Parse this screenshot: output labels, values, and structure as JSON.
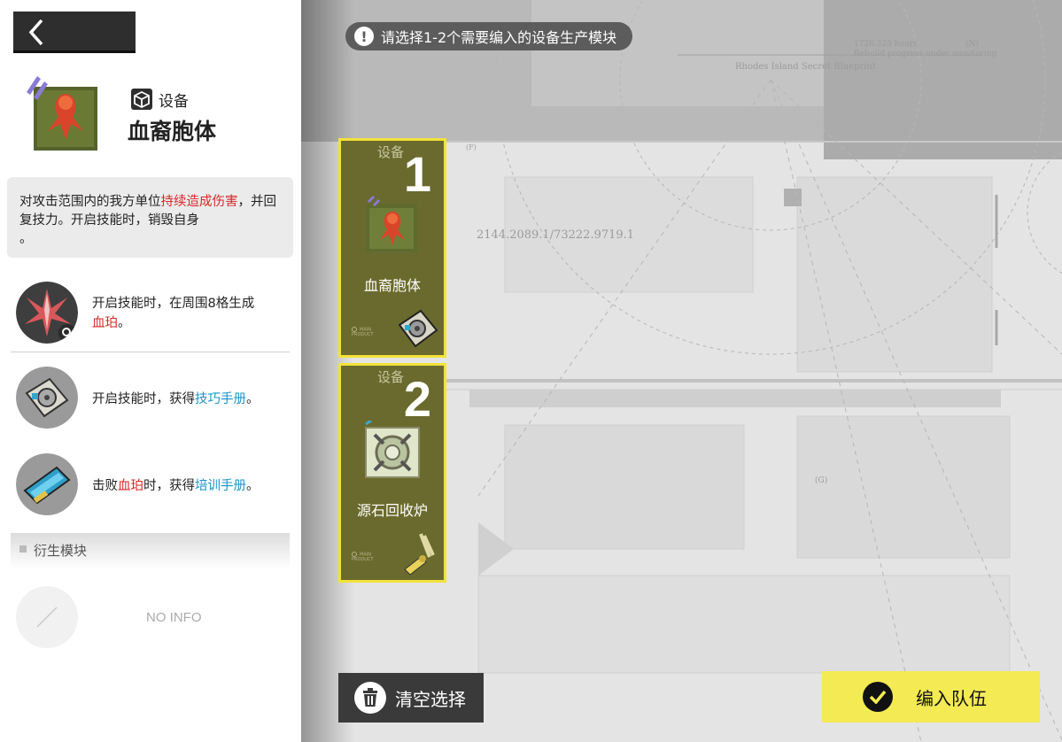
{
  "hint": "请选择1-2个需要编入的设备生产模块",
  "map": {
    "title": "Rhodes Island Secret Blueprint",
    "hours": "1726.325 hours",
    "progress": "Rebuild progress under monitoring",
    "north": "(N)",
    "coords": "2144.2089.1/73222.9719.1",
    "label_f": "(F)",
    "label_g": "(G)"
  },
  "cards": [
    {
      "category": "设备",
      "number": "1",
      "name": "血裔胞体",
      "main_product": "MAIN\nPRODUCT"
    },
    {
      "category": "设备",
      "number": "2",
      "name": "源石回收炉",
      "main_product": "MAIN\nPRODUCT"
    }
  ],
  "buttons": {
    "clear": "清空选择",
    "confirm": "编入队伍"
  },
  "panel": {
    "type_label": "设备",
    "name": "血裔胞体",
    "description": {
      "part1": "对攻击范围内的我方单位",
      "highlight": "持续造成伤害",
      "part2": "，并回复技力。开启技能时，销毁自身",
      "part3": "。"
    },
    "effects": [
      {
        "text1": "开启技能时，在周围8格生成",
        "hl": "血珀",
        "text2": "。"
      },
      {
        "text1": "开启技能时，获得",
        "hl": "技巧手册",
        "text2": "。"
      },
      {
        "text1": "击败",
        "hl": "血珀",
        "text_mid": "时，获得",
        "hl2": "培训手册",
        "text2": "。"
      }
    ],
    "derived_title": "衍生模块",
    "no_info": "NO INFO"
  },
  "colors": {
    "card_bg": "#6a6a2e",
    "card_border": "#f3e23a",
    "confirm_bg": "#f4ea53",
    "highlight_red": "#d6282a",
    "highlight_blue": "#1d93c9"
  }
}
